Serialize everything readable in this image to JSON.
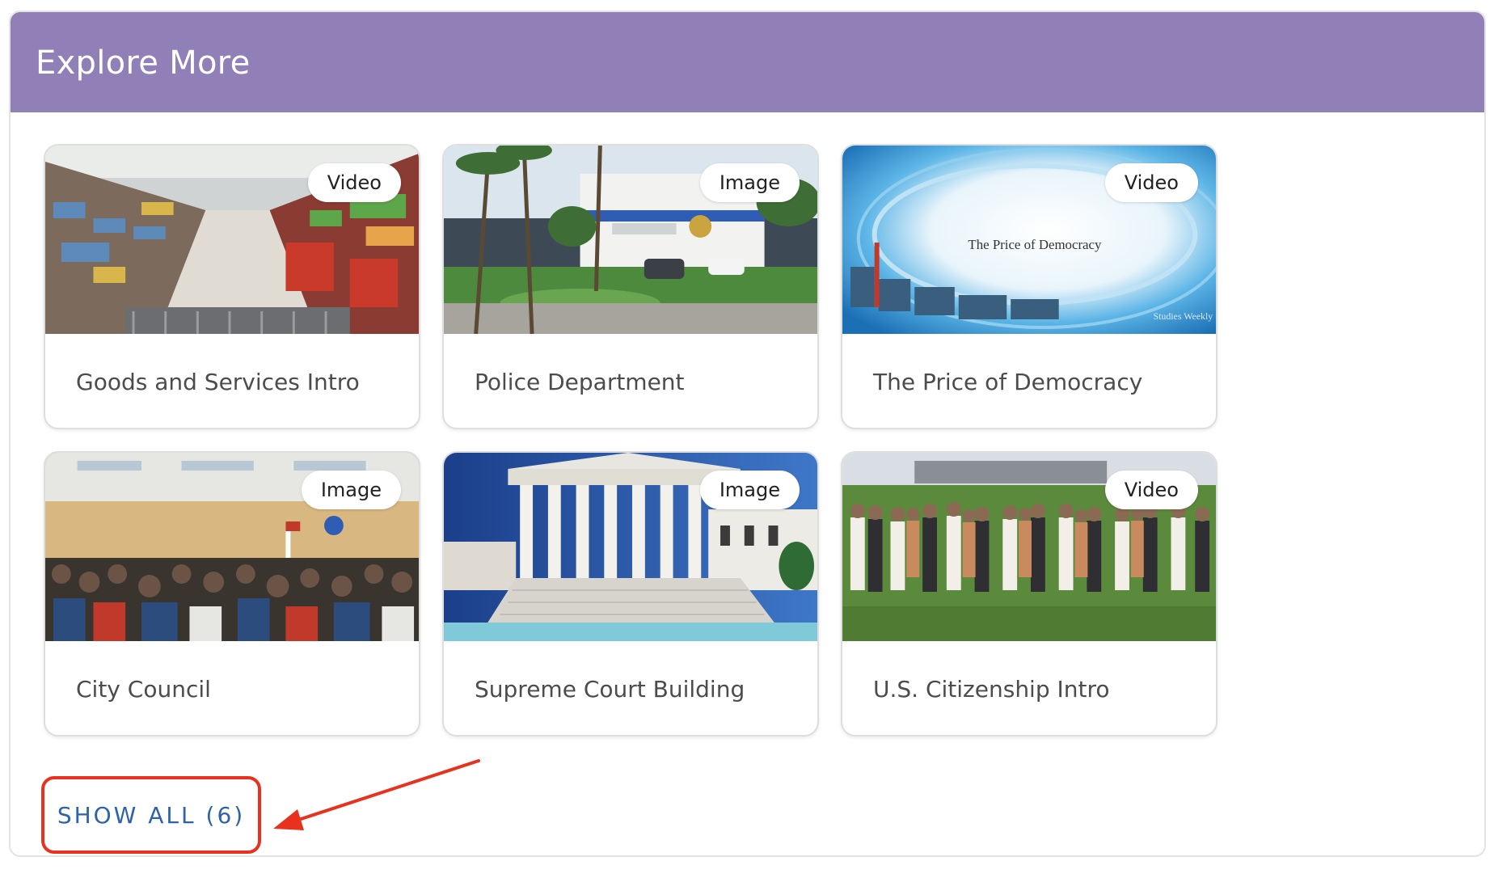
{
  "section": {
    "title": "Explore More"
  },
  "cards": [
    {
      "title": "Goods and Services Intro",
      "type": "Video",
      "thumb_icon": "grocery-aisle-photo"
    },
    {
      "title": "Police Department",
      "type": "Image",
      "thumb_icon": "police-building-photo"
    },
    {
      "title": "The Price of Democracy",
      "type": "Video",
      "thumb_icon": "price-of-democracy-thumbnail",
      "thumb_text": "The Price of Democracy",
      "thumb_logo": "Studies Weekly"
    },
    {
      "title": "City Council",
      "type": "Image",
      "thumb_icon": "city-council-chamber-photo"
    },
    {
      "title": "Supreme Court Building",
      "type": "Image",
      "thumb_icon": "supreme-court-photo"
    },
    {
      "title": "U.S. Citizenship Intro",
      "type": "Video",
      "thumb_icon": "citizenship-ceremony-photo"
    }
  ],
  "show_all": {
    "label": "SHOW ALL (6)"
  },
  "colors": {
    "header": "#917fb8",
    "link": "#2d63a8",
    "annotation": "#e8321e"
  }
}
